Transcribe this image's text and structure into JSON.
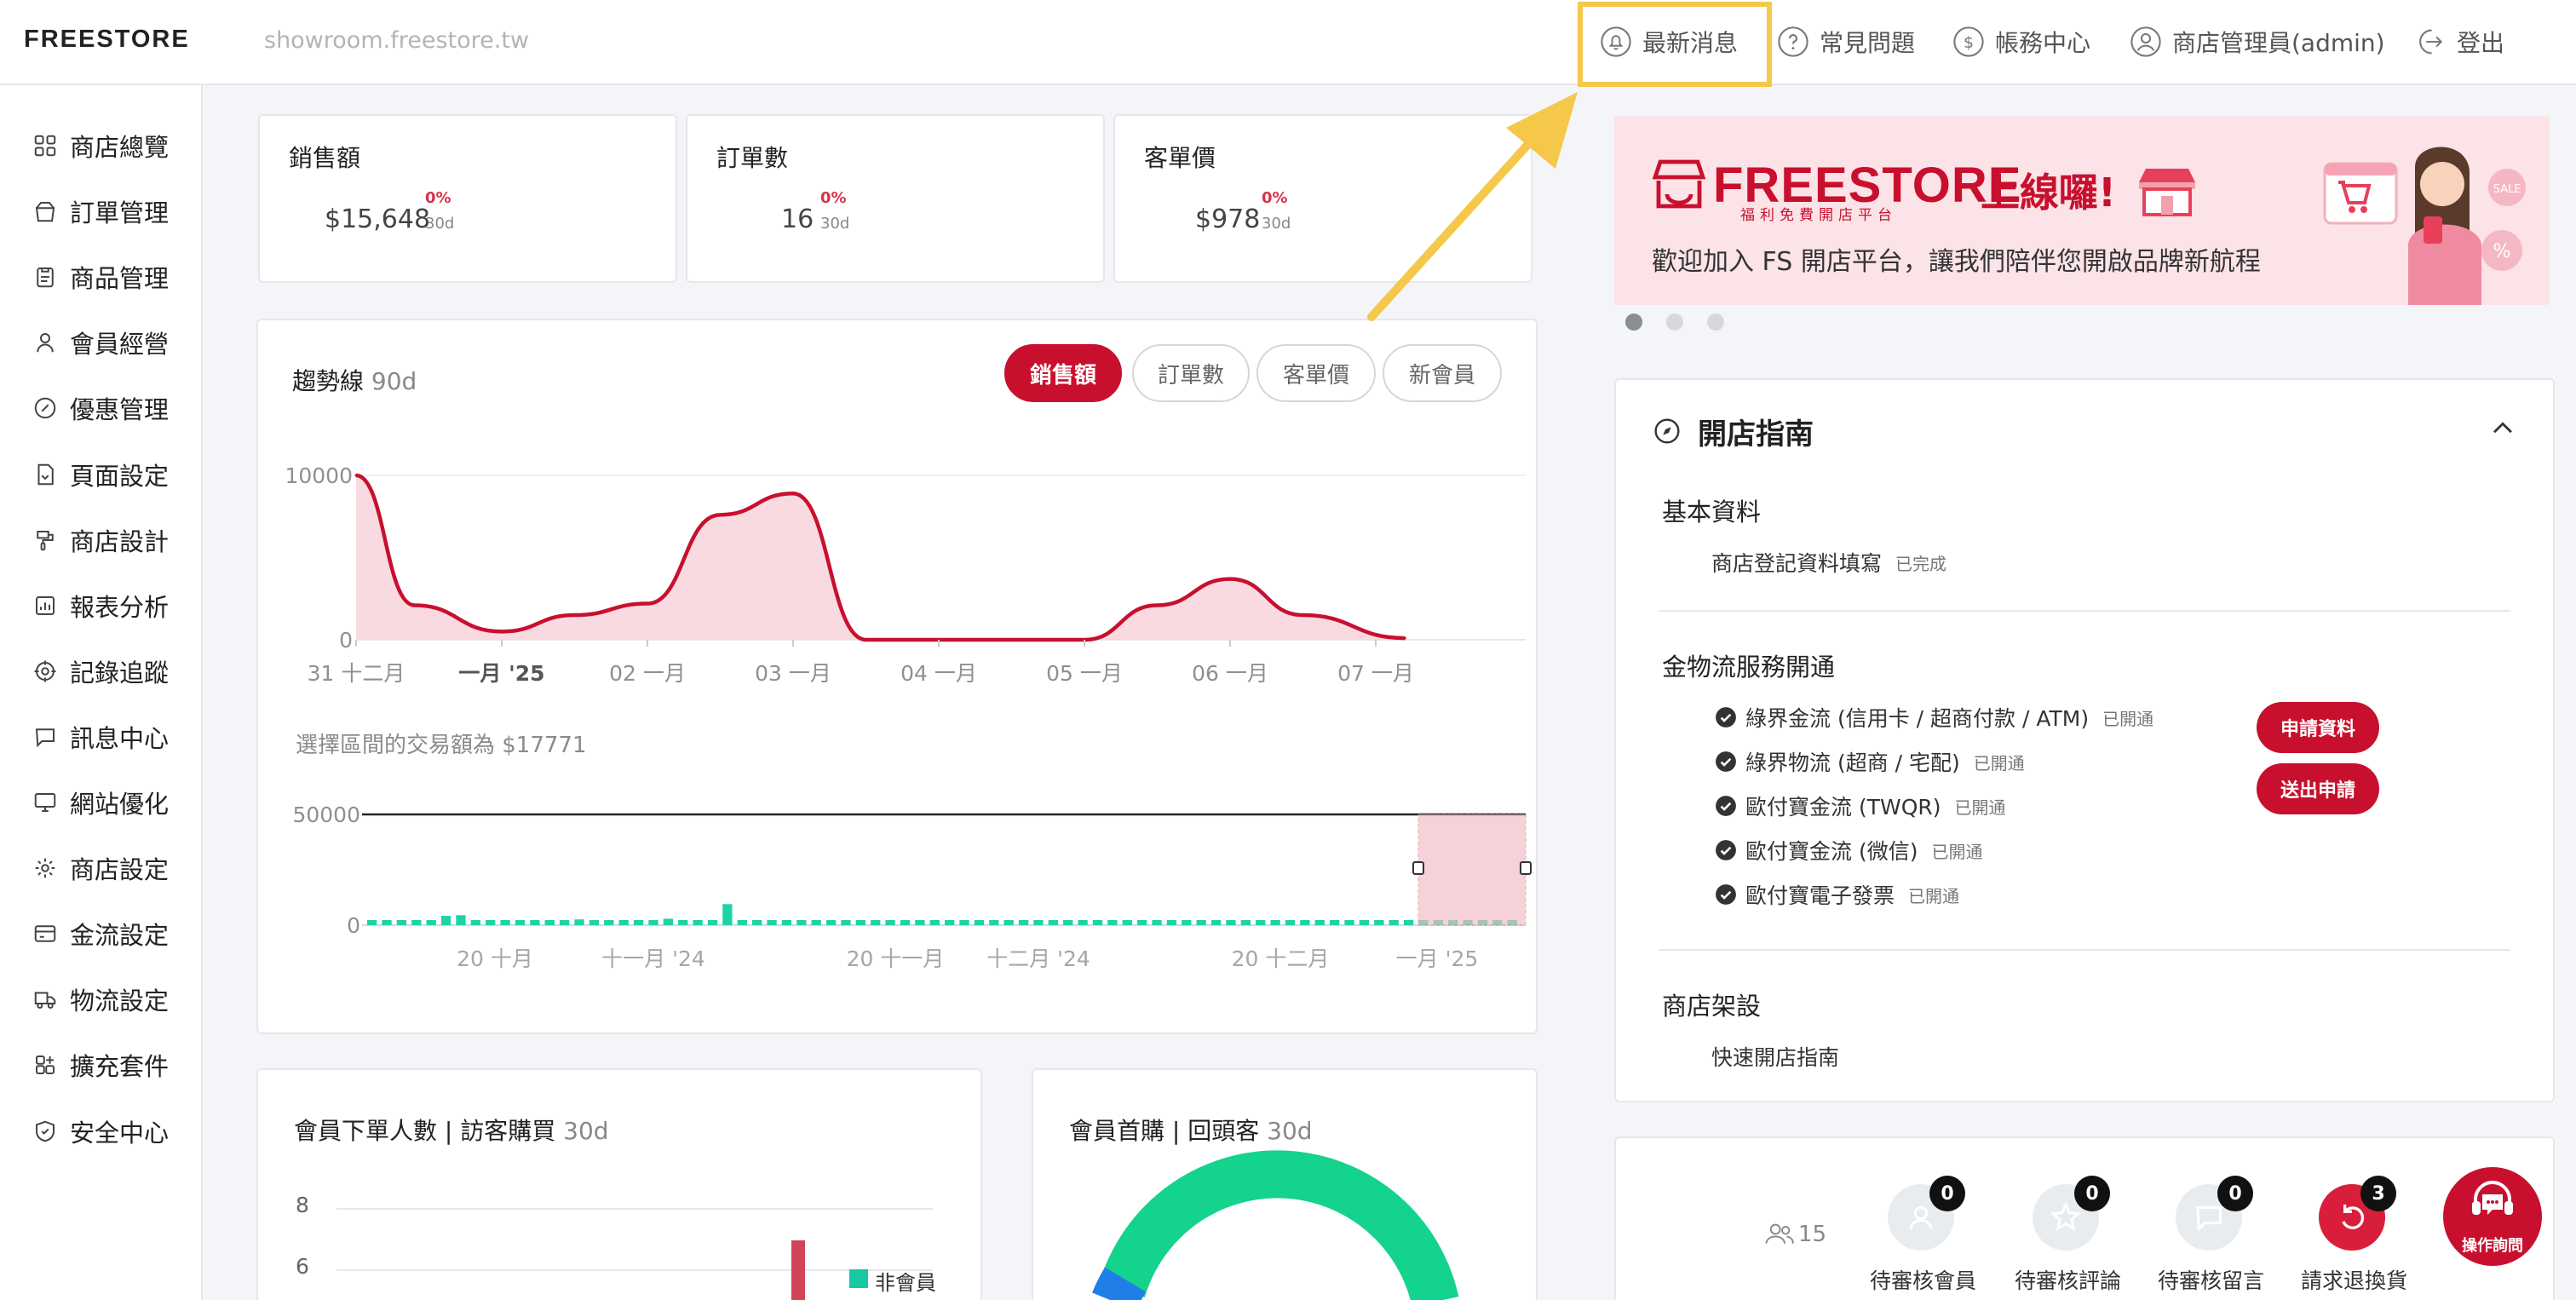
{
  "topbar": {
    "logo_a": "FREE",
    "logo_b": "STORE",
    "url": "showroom.freestore.tw",
    "nav": {
      "news": "最新消息",
      "faq": "常見問題",
      "billing": "帳務中心",
      "admin": "商店管理員(admin)",
      "logout": "登出"
    }
  },
  "sidebar": {
    "items": [
      "商店總覽",
      "訂單管理",
      "商品管理",
      "會員經營",
      "優惠管理",
      "頁面設定",
      "商店設計",
      "報表分析",
      "記錄追蹤",
      "訊息中心",
      "網站優化",
      "商店設定",
      "金流設定",
      "物流設定",
      "擴充套件",
      "安全中心"
    ]
  },
  "kpis": [
    {
      "title": "銷售額",
      "value": "$15,648",
      "pct": "0%",
      "period": "30d"
    },
    {
      "title": "訂單數",
      "value": "16",
      "pct": "0%",
      "period": "30d"
    },
    {
      "title": "客單價",
      "value": "$978",
      "pct": "0%",
      "period": "30d"
    }
  ],
  "trend": {
    "title": "趨勢線",
    "period": "90d",
    "tabs": [
      "銷售額",
      "訂單數",
      "客單價",
      "新會員"
    ],
    "active_tab": 0,
    "range_text": "選擇區間的交易額為 $17771",
    "accent": "#c8102e",
    "bar_color": "#1fd3a6"
  },
  "chart_data": [
    {
      "type": "area",
      "categories": [
        "31 十二月",
        "一月 '25",
        "02 一月",
        "03 一月",
        "04 一月",
        "05 一月",
        "06 一月",
        "07 一月"
      ],
      "bold_categories": [
        "一月 '25"
      ],
      "x": [
        0,
        0.4,
        1,
        1.5,
        2,
        2.5,
        3,
        3.5,
        4,
        4.5,
        5,
        5.5,
        6,
        6.5,
        7.2
      ],
      "values": [
        10000,
        2100,
        500,
        1500,
        2200,
        7600,
        8900,
        0,
        0,
        0,
        0,
        2100,
        3700,
        1500,
        100
      ],
      "yticks": [
        0,
        10000
      ],
      "ylim": [
        0,
        10000
      ]
    },
    {
      "type": "bar",
      "categories": [
        "20 十月",
        "十一月 '24",
        "20 十一月",
        "十二月 '24",
        "20 十二月",
        "一月 '25"
      ],
      "values": [
        350,
        330,
        330,
        360,
        380,
        4200,
        4500,
        1600,
        1200,
        800,
        600,
        400,
        2200,
        1300,
        2600,
        1100,
        350,
        1800,
        2300,
        1000,
        2900,
        1100,
        600,
        400,
        9500,
        600,
        1400,
        700,
        380,
        420,
        350,
        320,
        300,
        310,
        290,
        330,
        320,
        300,
        310,
        280,
        300,
        290,
        310,
        320,
        300,
        280,
        300,
        290,
        320,
        300,
        1800,
        330,
        300,
        290,
        310,
        300,
        280,
        300,
        310,
        290,
        320,
        300,
        280,
        300,
        310,
        290,
        300,
        280,
        300,
        310,
        290,
        300,
        280,
        300,
        310,
        290,
        300,
        280
      ],
      "yticks": [
        0,
        50000
      ],
      "ylim": [
        0,
        50000
      ]
    }
  ],
  "banner": {
    "brand": "FREESTORE",
    "brand_sub": "福利免費開店平台",
    "headline": "上線囉!",
    "tagline": "歡迎加入 FS 開店平台，讓我們陪伴您開啟品牌新航程",
    "sale_tag": "SALE",
    "pct_tag": "%"
  },
  "guide": {
    "title": "開店指南",
    "sections": [
      {
        "heading": "基本資料",
        "items": [
          {
            "text": "商店登記資料填寫",
            "status": "已完成"
          }
        ]
      },
      {
        "heading": "金物流服務開通",
        "items": [
          {
            "text": "綠界金流 (信用卡 / 超商付款 / ATM)",
            "status": "已開通"
          },
          {
            "text": "綠界物流 (超商 / 宅配)",
            "status": "已開通"
          },
          {
            "text": "歐付寶金流 (TWQR)",
            "status": "已開通"
          },
          {
            "text": "歐付寶金流 (微信)",
            "status": "已開通"
          },
          {
            "text": "歐付寶電子發票",
            "status": "已開通"
          }
        ]
      },
      {
        "heading": "商店架設",
        "items": [
          {
            "text": "快速開店指南",
            "status": ""
          }
        ]
      }
    ],
    "apply_info": "申請資料",
    "submit_apply": "送出申請"
  },
  "members_card": {
    "title": "會員下單人數 | 訪客購買",
    "period": "30d",
    "yticks": [
      "8",
      "6"
    ],
    "legend": "非會員"
  },
  "first_buy_card": {
    "title": "會員首購 | 回頭客",
    "period": "30d"
  },
  "pending": {
    "member_count": "15",
    "items": [
      {
        "label": "待審核會員",
        "count": "0"
      },
      {
        "label": "待審核評論",
        "count": "0"
      },
      {
        "label": "待審核留言",
        "count": "0"
      },
      {
        "label": "請求退換貨",
        "count": "3"
      }
    ]
  },
  "help": {
    "label": "操作詢問"
  }
}
